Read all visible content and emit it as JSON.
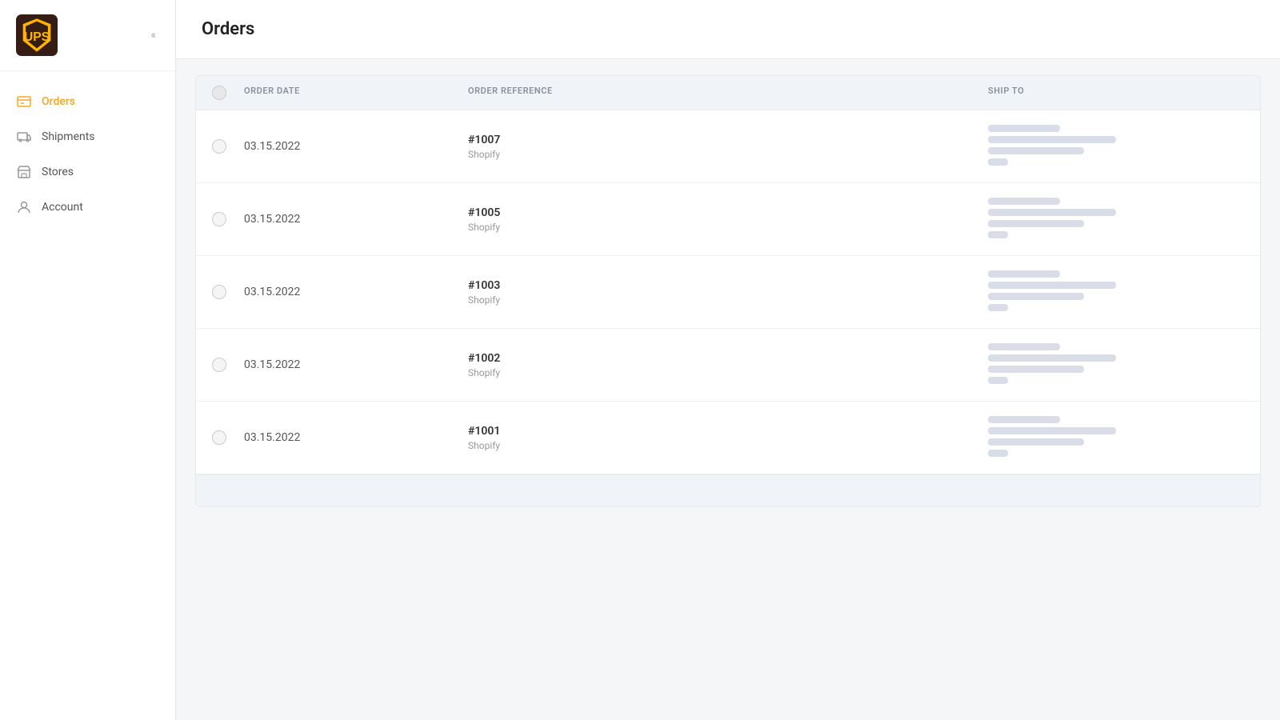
{
  "app": {
    "title": "Orders"
  },
  "sidebar": {
    "collapse_label": "«",
    "items": [
      {
        "id": "orders",
        "label": "Orders",
        "active": true
      },
      {
        "id": "shipments",
        "label": "Shipments",
        "active": false
      },
      {
        "id": "stores",
        "label": "Stores",
        "active": false
      },
      {
        "id": "account",
        "label": "Account",
        "active": false
      }
    ]
  },
  "table": {
    "columns": [
      {
        "id": "checkbox",
        "label": ""
      },
      {
        "id": "order_date",
        "label": "ORDER DATE"
      },
      {
        "id": "order_reference",
        "label": "ORDER REFERENCE"
      },
      {
        "id": "ship_to",
        "label": "SHIP TO"
      }
    ],
    "rows": [
      {
        "id": "1007",
        "date": "03.15.2022",
        "reference": "#1007",
        "source": "Shopify"
      },
      {
        "id": "1005",
        "date": "03.15.2022",
        "reference": "#1005",
        "source": "Shopify"
      },
      {
        "id": "1003",
        "date": "03.15.2022",
        "reference": "#1003",
        "source": "Shopify"
      },
      {
        "id": "1002",
        "date": "03.15.2022",
        "reference": "#1002",
        "source": "Shopify"
      },
      {
        "id": "1001",
        "date": "03.15.2022",
        "reference": "#1001",
        "source": "Shopify"
      }
    ]
  }
}
